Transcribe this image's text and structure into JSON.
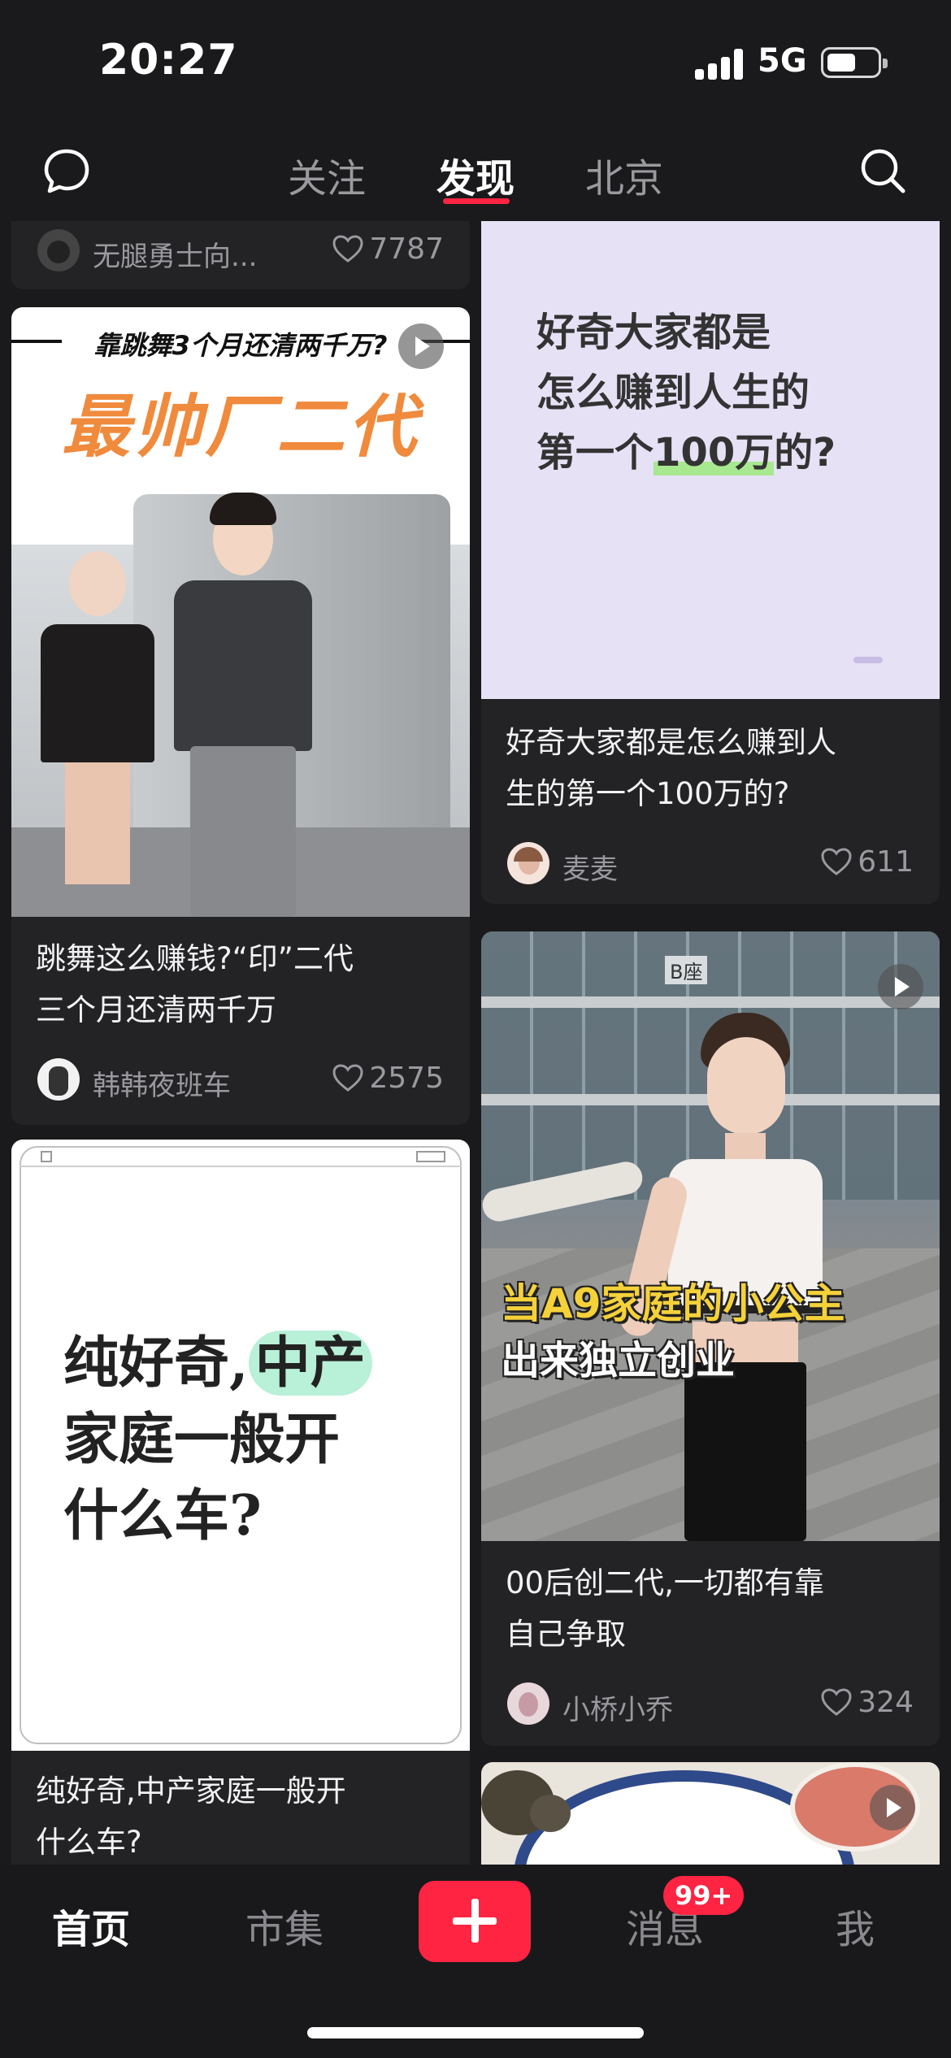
{
  "status": {
    "time": "20:27",
    "network": "5G"
  },
  "topnav": {
    "tabs": [
      "关注",
      "发现",
      "北京"
    ],
    "active_tab": "发现"
  },
  "feed": {
    "card_top_left": {
      "author": "无腿勇士向...",
      "likes": "7787"
    },
    "card_dance": {
      "image_banner": "靠跳舞3个月还清两千万?",
      "image_headline": "最帅厂二代",
      "title_line1": "跳舞这么赚钱?“印”二代",
      "title_line2": "三个月还清两千万",
      "author": "韩韩夜班车",
      "likes": "2575"
    },
    "card_car": {
      "image_line1": "纯好奇,",
      "image_highlight": "中产",
      "image_line2": "家庭一般开",
      "image_line3": "什么车?",
      "title_line1": "纯好奇,中产家庭一般开",
      "title_line2": "什么车?"
    },
    "card_million": {
      "image_line1": "好奇大家都是",
      "image_line2": "怎么赚到人生的",
      "image_line3_prefix": "第一个",
      "image_line3_highlight": "100万",
      "image_line3_suffix": "的?",
      "title_line1": "好奇大家都是怎么赚到人",
      "title_line2": "生的第一个100万的?",
      "author": "麦麦",
      "likes": "611"
    },
    "card_princess": {
      "image_caption1": "当A9家庭的小公主",
      "image_caption2": "出来独立创业",
      "image_sign": "B座",
      "title_line1": "00后创二代,一切都有靠",
      "title_line2": "自己争取",
      "author": "小桥小乔",
      "likes": "324"
    }
  },
  "bottomnav": {
    "home": "首页",
    "market": "市集",
    "messages": "消息",
    "messages_badge": "99+",
    "me": "我"
  },
  "colors": {
    "accent": "#ff2442",
    "background": "#1a1a1c",
    "card": "#232326",
    "highlight_green": "#b8f0d8",
    "highlight_orange": "#f08a3c"
  }
}
